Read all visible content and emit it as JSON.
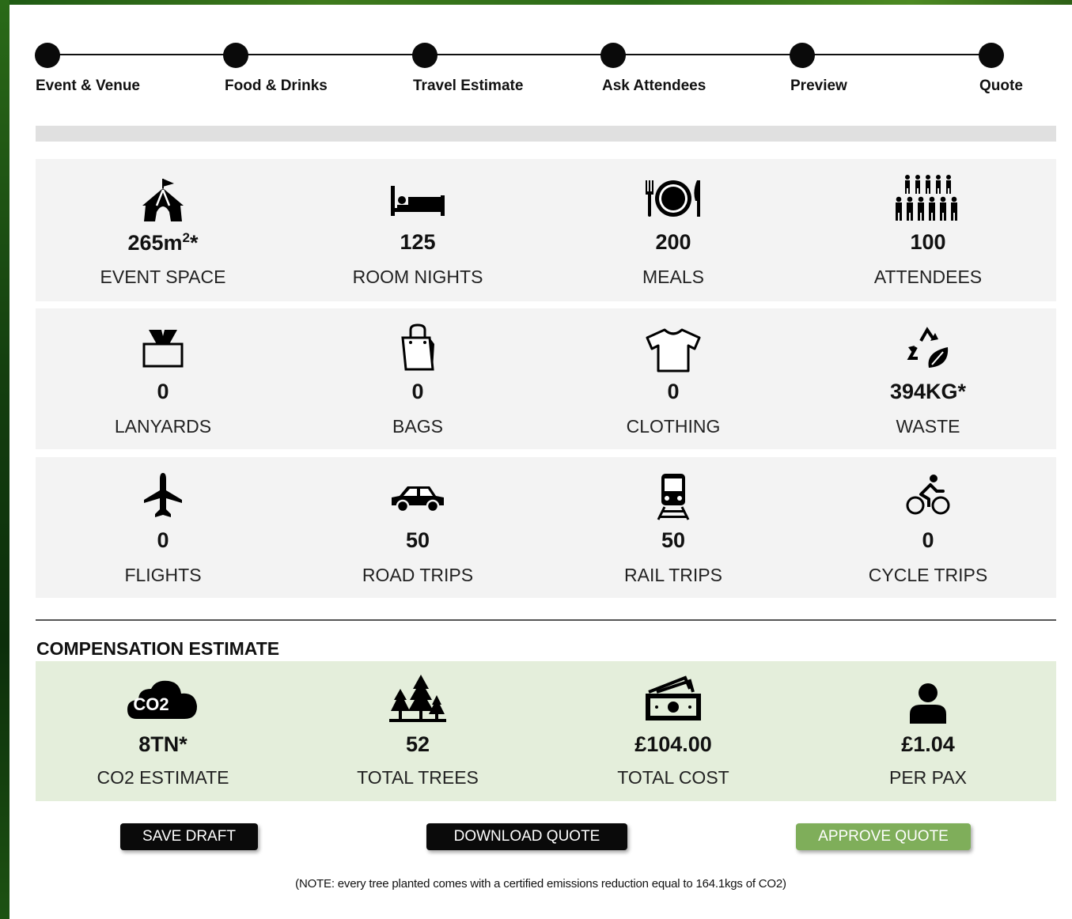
{
  "steps": [
    {
      "label": "Event & Venue"
    },
    {
      "label": "Food & Drinks"
    },
    {
      "label": "Travel Estimate"
    },
    {
      "label": "Ask Attendees"
    },
    {
      "label": "Preview"
    },
    {
      "label": "Quote"
    }
  ],
  "usage_rows": [
    [
      {
        "icon": "tent-icon",
        "value": "265m",
        "sup": "2",
        "suffix": "*",
        "label": "EVENT SPACE"
      },
      {
        "icon": "bed-icon",
        "value": "125",
        "label": "ROOM NIGHTS"
      },
      {
        "icon": "plate-cutlery-icon",
        "value": "200",
        "label": "MEALS"
      },
      {
        "icon": "people-group-icon",
        "value": "100",
        "label": "ATTENDEES"
      }
    ],
    [
      {
        "icon": "lanyard-icon",
        "value": "0",
        "label": "LANYARDS"
      },
      {
        "icon": "bag-icon",
        "value": "0",
        "label": "BAGS"
      },
      {
        "icon": "tshirt-icon",
        "value": "0",
        "label": "CLOTHING"
      },
      {
        "icon": "recycle-leaf-icon",
        "value": "394KG*",
        "label": "WASTE"
      }
    ],
    [
      {
        "icon": "plane-icon",
        "value": "0",
        "label": "FLIGHTS"
      },
      {
        "icon": "car-icon",
        "value": "50",
        "label": "ROAD TRIPS"
      },
      {
        "icon": "train-icon",
        "value": "50",
        "label": "RAIL TRIPS"
      },
      {
        "icon": "cyclist-icon",
        "value": "0",
        "label": "CYCLE TRIPS"
      }
    ]
  ],
  "compensation": {
    "title": "COMPENSATION ESTIMATE",
    "items": [
      {
        "icon": "co2-cloud-icon",
        "icon_text": "CO2",
        "value": "8TN*",
        "label": "CO2 ESTIMATE"
      },
      {
        "icon": "trees-icon",
        "value": "52",
        "label": "TOTAL TREES"
      },
      {
        "icon": "money-icon",
        "value": "£104.00",
        "label": "TOTAL COST"
      },
      {
        "icon": "person-icon",
        "value": "£1.04",
        "label": "PER PAX"
      }
    ]
  },
  "buttons": {
    "save_draft": "SAVE DRAFT",
    "download_quote": "DOWNLOAD QUOTE",
    "approve_quote": "APPROVE QUOTE"
  },
  "note": "(NOTE: every tree planted comes with a certified emissions reduction equal to 164.1kgs of CO2)",
  "colors": {
    "compensation_bg": "#e4eedb",
    "approve_green": "#7fae5a",
    "stat_bg": "#f3f3f3",
    "background_green": "#1e5a14"
  }
}
